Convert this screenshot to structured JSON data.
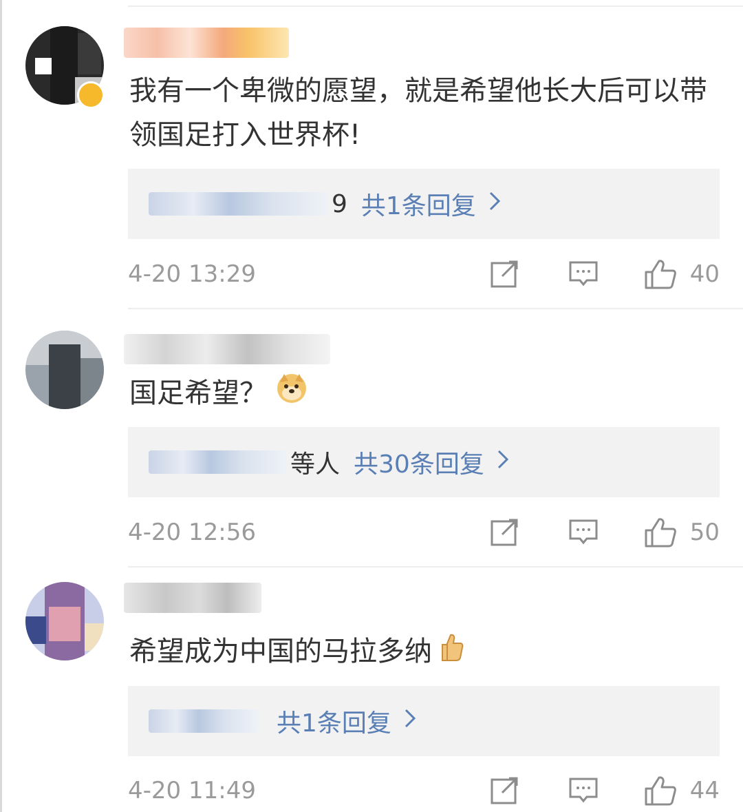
{
  "comments": [
    {
      "content": "我有一个卑微的愿望，就是希望他长大后可以带领国足打入世界杯!",
      "reply_name_tail": "9",
      "reply_count": "共1条回复",
      "timestamp": "4-20 13:29",
      "likes": "40",
      "emoji": ""
    },
    {
      "content": "国足希望？",
      "reply_name_tail": "等人",
      "reply_count": "共30条回复",
      "timestamp": "4-20 12:56",
      "likes": "50",
      "emoji": "doge-emoji"
    },
    {
      "content": "希望成为中国的马拉多纳",
      "reply_name_tail": "",
      "reply_count": "共1条回复",
      "timestamp": "4-20 11:49",
      "likes": "44",
      "emoji": "thumbs-up-emoji"
    }
  ],
  "icons": {
    "share": "share-icon",
    "comment": "comment-icon",
    "like": "thumbs-up-icon",
    "chevron": "chevron-right-icon"
  },
  "colors": {
    "link": "#5a7fb5",
    "meta": "#9a9a9a",
    "reply_bg": "#f2f2f2"
  }
}
